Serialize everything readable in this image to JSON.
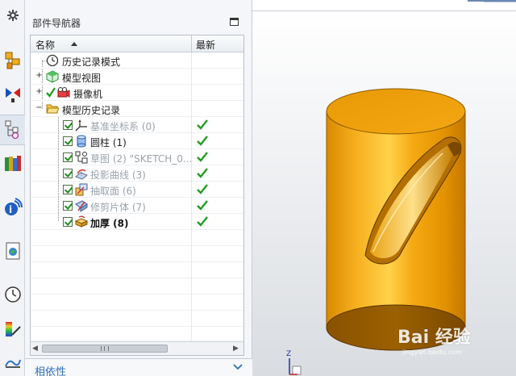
{
  "navigator": {
    "title": "部件导航器",
    "columns": {
      "name": "名称",
      "latest": "最新"
    },
    "rows": [
      {
        "label": "历史记录模式",
        "style": "normal",
        "icon": "clock-icon",
        "checkbox": false,
        "latest_ok": false
      },
      {
        "label": "模型视图",
        "style": "normal",
        "icon": "model-views-icon",
        "checkbox": false,
        "latest_ok": false
      },
      {
        "label": "摄像机",
        "style": "normal",
        "icon": "camera-icon",
        "checkbox": false,
        "latest_ok": false
      },
      {
        "label": "模型历史记录",
        "style": "normal",
        "icon": "folder-open-icon",
        "checkbox": false,
        "latest_ok": false
      },
      {
        "label": "基准坐标系 (0)",
        "style": "dim",
        "icon": "datum-csys-icon",
        "checkbox": true,
        "latest_ok": true
      },
      {
        "label": "圆柱 (1)",
        "style": "normal",
        "icon": "cylinder-icon",
        "checkbox": true,
        "latest_ok": true
      },
      {
        "label": "草图 (2) \"SKETCH_0...",
        "style": "dim",
        "icon": "sketch-icon",
        "checkbox": true,
        "latest_ok": true
      },
      {
        "label": "投影曲线 (3)",
        "style": "dim",
        "icon": "project-curve-icon",
        "checkbox": true,
        "latest_ok": true
      },
      {
        "label": "抽取面 (6)",
        "style": "dim",
        "icon": "extract-face-icon",
        "checkbox": true,
        "latest_ok": true
      },
      {
        "label": "修剪片体 (7)",
        "style": "dim",
        "icon": "trim-sheet-icon",
        "checkbox": true,
        "latest_ok": true
      },
      {
        "label": "加厚 (8)",
        "style": "bold",
        "icon": "thicken-icon",
        "checkbox": true,
        "latest_ok": true
      }
    ],
    "dependencies_label": "相依性"
  },
  "resource_bar": [
    "settings-gear-icon",
    "assembly-navigator-icon",
    "constraint-navigator-icon",
    "part-navigator-icon",
    "reuse-library-icon",
    "hd3d-tools-icon",
    "web-browser-icon",
    "history-icon",
    "system-materials-icon",
    "process-studio-icon"
  ],
  "viewport": {
    "triad_label": "Z",
    "watermark": "Bai 经验",
    "watermark_sub": "jingyan.baidu.com"
  },
  "colors": {
    "part_orange": "#f4a20c",
    "check_green": "#1e9e1e",
    "dependency_blue": "#2f6fb8"
  }
}
